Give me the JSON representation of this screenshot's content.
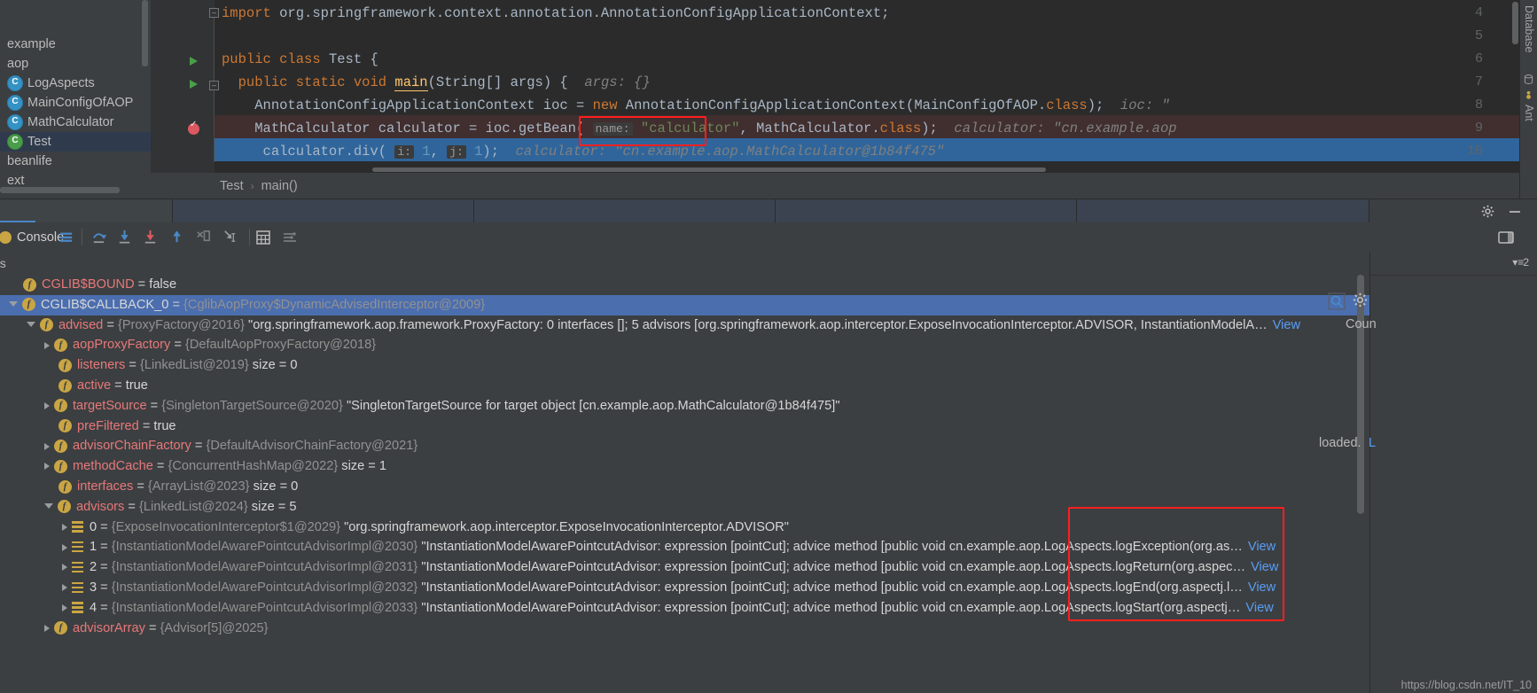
{
  "project_tree": {
    "items": [
      {
        "label": "example",
        "type": "folder"
      },
      {
        "label": "aop",
        "type": "folder"
      },
      {
        "label": "LogAspects",
        "type": "class"
      },
      {
        "label": "MainConfigOfAOP",
        "type": "class"
      },
      {
        "label": "MathCalculator",
        "type": "class"
      },
      {
        "label": "Test",
        "type": "class-runnable",
        "selected": true
      },
      {
        "label": "beanlife",
        "type": "folder"
      },
      {
        "label": "ext",
        "type": "folder"
      }
    ]
  },
  "editor": {
    "lines": [
      {
        "number": "4",
        "text": "import org.springframework.context.annotation.AnnotationConfigApplicationContext;"
      },
      {
        "number": "5",
        "text": ""
      },
      {
        "number": "6",
        "text": "public class Test {"
      },
      {
        "number": "7",
        "text": "public static void main(String[] args) {",
        "hint": "args: {}"
      },
      {
        "number": "8",
        "text": "AnnotationConfigApplicationContext ioc = new AnnotationConfigApplicationContext(MainConfigOfAOP.class);",
        "hint": "ioc: \""
      },
      {
        "number": "9",
        "text": "MathCalculator calculator = ioc.getBean( name: \"calculator\", MathCalculator.class);",
        "hint": "calculator: \"cn.example.aop"
      },
      {
        "number": "10",
        "text": "calculator.div( i: 1,  j: 1);",
        "hint": "calculator: \"cn.example.aop.MathCalculator@1b84f475\""
      }
    ],
    "param_hint_name_i": "i:",
    "param_hint_name_j": "j:",
    "param_hint_name": "name:",
    "breadcrumb": {
      "class": "Test",
      "method": "main()",
      "separator": "›"
    }
  },
  "right_toolbar": {
    "items": [
      {
        "label": "Database",
        "icon": "database-icon"
      },
      {
        "label": "Ant",
        "icon": "ant-icon"
      }
    ]
  },
  "debug_toolbar": {
    "console_label": "Console",
    "buttons": [
      {
        "name": "console-tab",
        "label": "Console"
      },
      {
        "name": "show-options-menu-button",
        "icon": "lines-icon"
      },
      {
        "name": "step-over-button",
        "icon": "step-over-icon"
      },
      {
        "name": "step-into-button",
        "icon": "step-into-icon"
      },
      {
        "name": "force-step-into-button",
        "icon": "force-step-into-icon"
      },
      {
        "name": "step-out-button",
        "icon": "step-out-icon"
      },
      {
        "name": "drop-frame-button",
        "icon": "drop-frame-icon"
      },
      {
        "name": "run-to-cursor-button",
        "icon": "run-to-cursor-icon"
      },
      {
        "name": "evaluate-expression-button",
        "icon": "calculator-icon"
      },
      {
        "name": "settings-sort-button",
        "icon": "sort-icon"
      }
    ]
  },
  "variables_header": {
    "label": "es"
  },
  "variables": [
    {
      "indent": 0,
      "arrow": "none",
      "icon": "f",
      "name": "CGLIB$BOUND",
      "eq": " = ",
      "value": "false",
      "selected": false
    },
    {
      "indent": 0,
      "arrow": "open",
      "icon": "f",
      "name": "CGLIB$CALLBACK_0",
      "eq": " = ",
      "type": "{CglibAopProxy$DynamicAdvisedInterceptor@2009}",
      "selected": true,
      "white": true
    },
    {
      "indent": 1,
      "arrow": "open",
      "icon": "f",
      "name": "advised",
      "eq": " = ",
      "type": "{ProxyFactory@2016}",
      "value": "\"org.springframework.aop.framework.ProxyFactory: 0 interfaces []; 5 advisors [org.springframework.aop.interceptor.ExposeInvocationInterceptor.ADVISOR, InstantiationModelA…",
      "link": "View"
    },
    {
      "indent": 2,
      "arrow": "closed",
      "icon": "f",
      "name": "aopProxyFactory",
      "eq": " = ",
      "type": "{DefaultAopProxyFactory@2018}"
    },
    {
      "indent": 2,
      "arrow": "none",
      "icon": "f",
      "name": "listeners",
      "eq": " = ",
      "type": "{LinkedList@2019}",
      "value": "size = 0"
    },
    {
      "indent": 2,
      "arrow": "none",
      "icon": "f",
      "name": "active",
      "eq": " = ",
      "value": "true"
    },
    {
      "indent": 2,
      "arrow": "closed",
      "icon": "f",
      "name": "targetSource",
      "eq": " = ",
      "type": "{SingletonTargetSource@2020}",
      "value": "\"SingletonTargetSource for target object [cn.example.aop.MathCalculator@1b84f475]\""
    },
    {
      "indent": 2,
      "arrow": "none",
      "icon": "f",
      "name": "preFiltered",
      "eq": " = ",
      "value": "true"
    },
    {
      "indent": 2,
      "arrow": "closed",
      "icon": "f",
      "name": "advisorChainFactory",
      "eq": " = ",
      "type": "{DefaultAdvisorChainFactory@2021}"
    },
    {
      "indent": 2,
      "arrow": "closed",
      "icon": "f",
      "name": "methodCache",
      "eq": " = ",
      "type": "{ConcurrentHashMap@2022}",
      "value": "size = 1"
    },
    {
      "indent": 2,
      "arrow": "none",
      "icon": "f",
      "name": "interfaces",
      "eq": " = ",
      "type": "{ArrayList@2023}",
      "value": "size = 0"
    },
    {
      "indent": 2,
      "arrow": "open",
      "icon": "f",
      "name": "advisors",
      "eq": " = ",
      "type": "{LinkedList@2024}",
      "value": "size = 5"
    },
    {
      "indent": 3,
      "arrow": "closed",
      "icon": "list",
      "name": "0",
      "eq": " = ",
      "type": "{ExposeInvocationInterceptor$1@2029}",
      "value": "\"org.springframework.aop.interceptor.ExposeInvocationInterceptor.ADVISOR\"",
      "white": true
    },
    {
      "indent": 3,
      "arrow": "closed",
      "icon": "list",
      "name": "1",
      "eq": " = ",
      "type": "{InstantiationModelAwarePointcutAdvisorImpl@2030}",
      "value": "\"InstantiationModelAwarePointcutAdvisor: expression [pointCut]; advice method [public void cn.example.aop.LogAspects.logException(org.as…",
      "link": "View",
      "white": true
    },
    {
      "indent": 3,
      "arrow": "closed",
      "icon": "list",
      "name": "2",
      "eq": " = ",
      "type": "{InstantiationModelAwarePointcutAdvisorImpl@2031}",
      "value": "\"InstantiationModelAwarePointcutAdvisor: expression [pointCut]; advice method [public void cn.example.aop.LogAspects.logReturn(org.aspec…",
      "link": "View",
      "white": true
    },
    {
      "indent": 3,
      "arrow": "closed",
      "icon": "list",
      "name": "3",
      "eq": " = ",
      "type": "{InstantiationModelAwarePointcutAdvisorImpl@2032}",
      "value": "\"InstantiationModelAwarePointcutAdvisor: expression [pointCut]; advice method [public void cn.example.aop.LogAspects.logEnd(org.aspectj.l…",
      "link": "View",
      "white": true
    },
    {
      "indent": 3,
      "arrow": "closed",
      "icon": "list",
      "name": "4",
      "eq": " = ",
      "type": "{InstantiationModelAwarePointcutAdvisorImpl@2033}",
      "value": "\"InstantiationModelAwarePointcutAdvisor: expression [pointCut]; advice method [public void cn.example.aop.LogAspects.logStart(org.aspectj…",
      "link": "View",
      "white": true
    },
    {
      "indent": 2,
      "arrow": "closed",
      "icon": "f",
      "name": "advisorArray",
      "eq": " = ",
      "type": "{Advisor[5]@2025}"
    }
  ],
  "right_panel": {
    "count_label": "Coun",
    "loaded_label": "loaded.",
    "loaded_link": "L",
    "badge": "2"
  },
  "watermark": "https://blog.csdn.net/IT_10",
  "colors": {
    "accent_blue": "#4b6eaf",
    "selection_blue": "#2f659b",
    "exec_line": "#412e2e",
    "red_box": "#ff1f1f",
    "editor_bg": "#2b2b2b",
    "panel_bg": "#3c3f41",
    "field_icon": "#c9a544",
    "name_red": "#e8787a",
    "link_blue": "#589df6"
  }
}
